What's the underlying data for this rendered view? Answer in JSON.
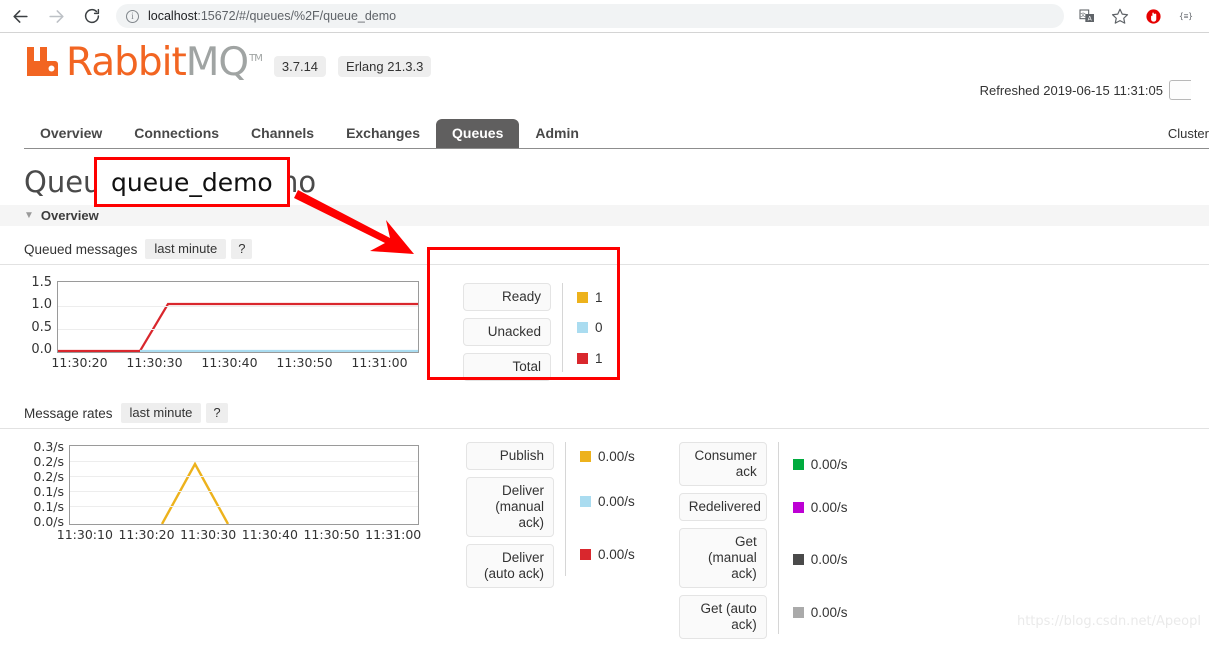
{
  "browser": {
    "back_icon": "arrow-left-icon",
    "forward_icon": "arrow-right-icon",
    "reload_icon": "reload-icon",
    "site_info_icon": "info-icon",
    "url_host": "localhost",
    "url_rest": ":15672/#/queues/%2F/queue_demo",
    "url_full": "localhost:15672/#/queues/%2F/queue_demo",
    "extensions": [
      "translate-icon",
      "bookmark-star-icon",
      "adblock-icon",
      "menu-icon"
    ]
  },
  "header": {
    "logo_rabbit": "Rabbit",
    "logo_mq": "MQ",
    "logo_tm": "TM",
    "version_badge": "3.7.14",
    "erlang_badge": "Erlang 21.3.3",
    "refreshed_label": "Refreshed 2019-06-15 11:31:05",
    "cluster_label": "Cluster"
  },
  "nav": {
    "tabs": [
      {
        "label": "Overview",
        "active": false
      },
      {
        "label": "Connections",
        "active": false
      },
      {
        "label": "Channels",
        "active": false
      },
      {
        "label": "Exchanges",
        "active": false
      },
      {
        "label": "Queues",
        "active": true
      },
      {
        "label": "Admin",
        "active": false
      }
    ]
  },
  "page": {
    "title": "Queue queue_demo",
    "title_prefix": "Queue",
    "queue_name": "queue_demo",
    "section_overview": "Overview"
  },
  "queued_messages": {
    "title": "Queued messages",
    "range_pill": "last minute",
    "help_pill": "?",
    "legend": [
      {
        "label": "Ready",
        "value": "1",
        "color": "#edb21c"
      },
      {
        "label": "Unacked",
        "value": "0",
        "color": "#aadcf0"
      },
      {
        "label": "Total",
        "value": "1",
        "color": "#d9272d"
      }
    ]
  },
  "message_rates": {
    "title": "Message rates",
    "range_pill": "last minute",
    "help_pill": "?",
    "legend_col1": [
      {
        "label": "Publish",
        "value": "0.00/s",
        "color": "#edb21c"
      },
      {
        "label": "Deliver (manual ack)",
        "value": "0.00/s",
        "color": "#aadcf0"
      },
      {
        "label": "Deliver (auto ack)",
        "value": "0.00/s",
        "color": "#d9272d"
      }
    ],
    "legend_col2": [
      {
        "label": "Consumer ack",
        "value": "0.00/s",
        "color": "#00ab3e"
      },
      {
        "label": "Redelivered",
        "value": "0.00/s",
        "color": "#bd00d4"
      },
      {
        "label": "Get (manual ack)",
        "value": "0.00/s",
        "color": "#4a4a4a"
      },
      {
        "label": "Get (auto ack)",
        "value": "0.00/s",
        "color": "#aaaaaa"
      }
    ]
  },
  "annotations": {
    "title_highlight": "queue_demo",
    "arrow_color": "#fe0000",
    "box_color": "#fe0000"
  },
  "watermark": "https://blog.csdn.net/Apeopl",
  "chart_data": [
    {
      "type": "line",
      "title": "Queued messages",
      "subtitle": "last minute",
      "xlabel": "",
      "ylabel": "",
      "ylim": [
        0.0,
        1.5
      ],
      "yticks": [
        "0.0",
        "0.5",
        "1.0",
        "1.5"
      ],
      "xticks": [
        "11:30:20",
        "11:30:30",
        "11:30:40",
        "11:30:50",
        "11:31:00"
      ],
      "grid": true,
      "legend_position": "right",
      "series": [
        {
          "name": "Total",
          "color": "#d9272d",
          "x": [
            "11:30:15",
            "11:30:25",
            "11:30:30",
            "11:31:05"
          ],
          "values": [
            0,
            0,
            1,
            1
          ]
        },
        {
          "name": "Unacked",
          "color": "#aadcf0",
          "x": [
            "11:30:15",
            "11:31:05"
          ],
          "values": [
            0,
            0
          ]
        },
        {
          "name": "Ready",
          "color": "#edb21c",
          "x": [
            "11:30:15",
            "11:31:05"
          ],
          "values": [
            null,
            null
          ]
        }
      ]
    },
    {
      "type": "line",
      "title": "Message rates",
      "subtitle": "last minute",
      "xlabel": "",
      "ylabel": "",
      "ylim": [
        0.0,
        0.3
      ],
      "yticks": [
        "0.3/s",
        "0.2/s",
        "0.2/s",
        "0.1/s",
        "0.1/s",
        "0.0/s"
      ],
      "xticks": [
        "11:30:10",
        "11:30:20",
        "11:30:30",
        "11:30:40",
        "11:30:50",
        "11:31:00"
      ],
      "grid": true,
      "legend_position": "right",
      "series": [
        {
          "name": "Publish",
          "color": "#edb21c",
          "x": [
            "11:30:20",
            "11:30:25",
            "11:30:30"
          ],
          "values": [
            0.0,
            0.2,
            0.0
          ]
        }
      ]
    }
  ]
}
